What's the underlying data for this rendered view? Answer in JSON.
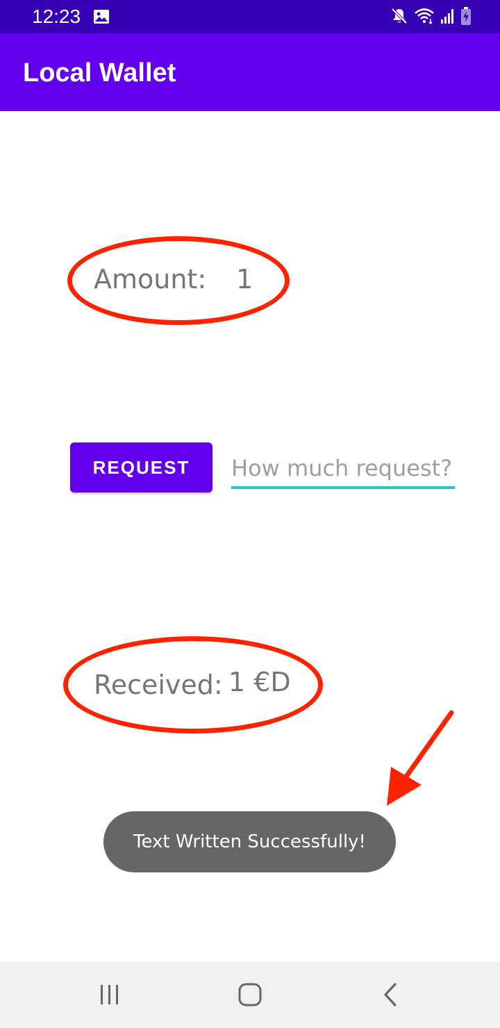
{
  "status_bar": {
    "time": "12:23",
    "icons": [
      "gallery-icon",
      "mute-icon",
      "wifi-icon",
      "signal-icon",
      "battery-charging-icon"
    ]
  },
  "app_bar": {
    "title": "Local Wallet"
  },
  "amount": {
    "label": "Amount:",
    "value": "1"
  },
  "request": {
    "button_label": "REQUEST",
    "input_value": "",
    "input_placeholder": "How much request?"
  },
  "received": {
    "label": "Received:",
    "value": "1 €D"
  },
  "toast": {
    "message": "Text Written Successfully!"
  },
  "nav_bar": {
    "icons": [
      "recents-icon",
      "home-icon",
      "back-icon"
    ]
  },
  "colors": {
    "status_bar": "#3700b3",
    "primary": "#6200ee",
    "accent": "#26c6b8",
    "annotation": "#ff2200",
    "toast_bg": "#666666",
    "text_secondary": "#757575"
  }
}
